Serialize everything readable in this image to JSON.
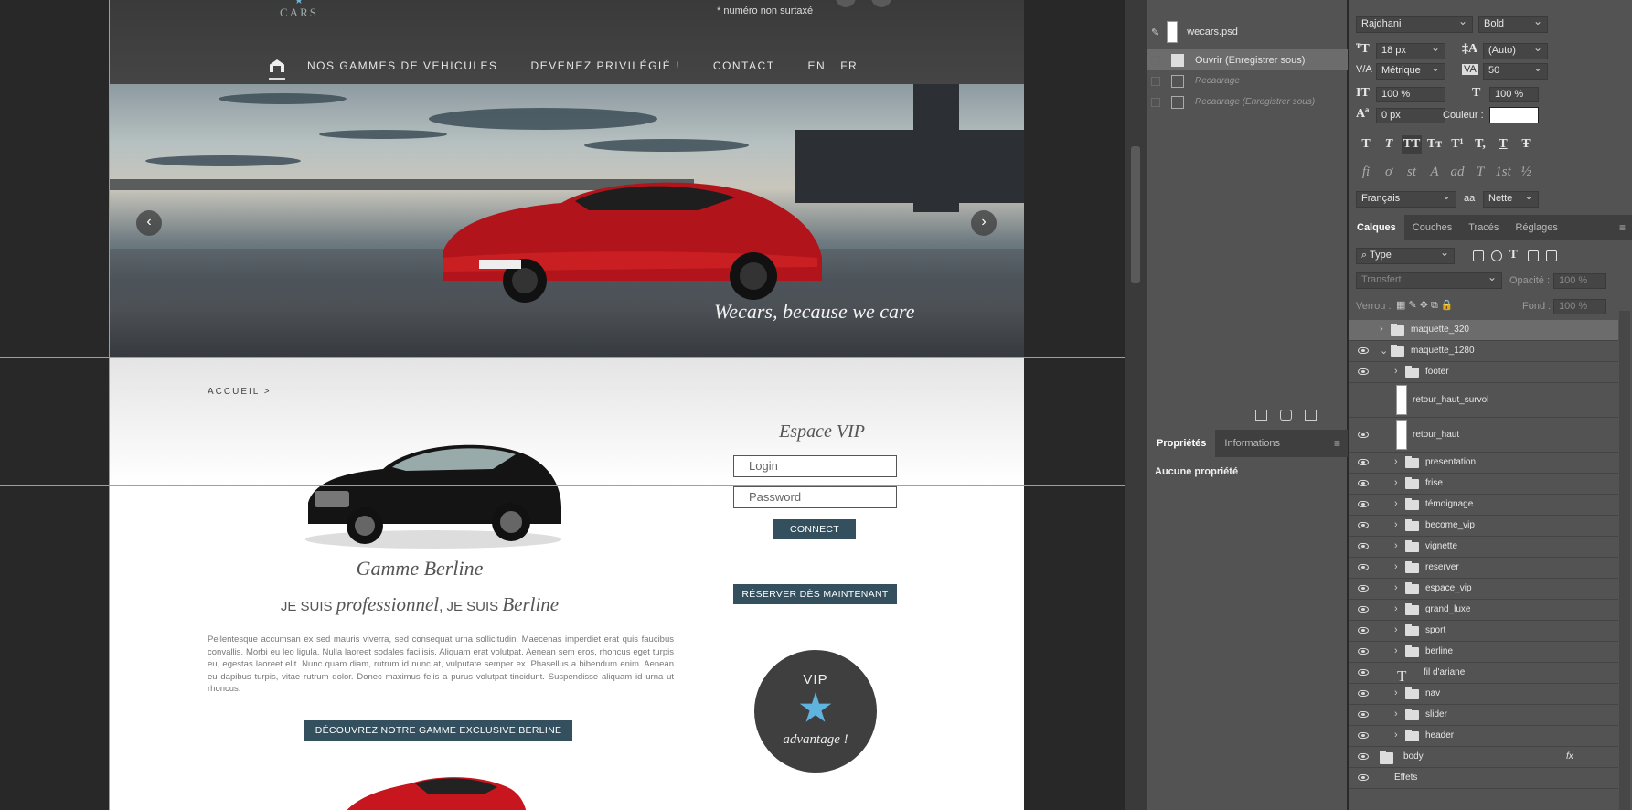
{
  "site": {
    "logo_text": "CARS",
    "subnote": "* numéro non surtaxé",
    "nav": [
      "NOS GAMMES DE VEHICULES",
      "DEVENEZ PRIVILÉGIÉ !",
      "CONTACT"
    ],
    "langs": [
      "EN",
      "FR"
    ],
    "slider_caption": "Wecars, because we care",
    "breadcrumb": "ACCUEIL >",
    "gamme_title": "Gamme Berline",
    "gamme_sub": {
      "a": "JE SUIS",
      "b": "professionnel",
      "c": ", JE SUIS",
      "d": "Berline"
    },
    "lorem": "Pellentesque accumsan ex sed mauris viverra, sed consequat urna sollicitudin. Maecenas imperdiet erat quis faucibus convallis. Morbi eu leo ligula. Nulla laoreet sodales facilisis. Aliquam erat volutpat. Aenean sem eros, rhoncus eget turpis eu, egestas laoreet elit. Nunc quam diam, rutrum id nunc at, vulputate semper ex. Phasellus a bibendum enim. Aenean eu dapibus turpis, vitae rutrum dolor. Donec maximus felis a purus volutpat tincidunt. Suspendisse aliquam id urna ut rhoncus.",
    "discover_btn": "DÉCOUVREZ NOTRE GAMME EXCLUSIVE BERLINE",
    "vip_title": "Espace VIP",
    "login_placeholder": "Login",
    "password_placeholder": "Password",
    "connect_btn": "CONNECT",
    "reserve_btn": "RÉSERVER DÈS MAINTENANT",
    "vip_badge": {
      "top": "VIP",
      "bottom": "advantage !"
    }
  },
  "history": {
    "snapshot": "wecars.psd",
    "items": [
      {
        "label": "Ouvrir (Enregistrer sous)",
        "selected": true
      },
      {
        "label": "Recadrage",
        "selected": false
      },
      {
        "label": "Recadrage (Enregistrer sous)",
        "selected": false
      }
    ]
  },
  "properties": {
    "tabs": [
      "Propriétés",
      "Informations"
    ],
    "empty_label": "Aucune propriété"
  },
  "character": {
    "font_family": "Rajdhani",
    "font_style": "Bold",
    "size": "18 px",
    "leading": "(Auto)",
    "kerning": "Métrique",
    "tracking": "50",
    "vscale": "100 %",
    "hscale": "100 %",
    "baseline": "0 px",
    "color_label": "Couleur :",
    "language": "Français",
    "antialias_label": "aa",
    "antialias": "Nette",
    "type_buttons": [
      "T",
      "T",
      "TT",
      "Tт",
      "T¹",
      "T,",
      "T",
      "Ŧ"
    ],
    "ot_buttons": [
      "fi",
      "ơ",
      "st",
      "A",
      "ad",
      "T",
      "1st",
      "½"
    ]
  },
  "layers_panel": {
    "tabs": [
      "Calques",
      "Couches",
      "Tracés",
      "Réglages"
    ],
    "filter": "Type",
    "blend": "Transfert",
    "opacity_label": "Opacité :",
    "opacity": "100 %",
    "lock_label": "Verrou :",
    "fill_label": "Fond :",
    "fill": "100 %",
    "layers": [
      {
        "name": "maquette_320",
        "kind": "folder",
        "level": 0,
        "visible": false,
        "selected": true
      },
      {
        "name": "maquette_1280",
        "kind": "folder",
        "level": 0,
        "visible": true,
        "open": true
      },
      {
        "name": "footer",
        "kind": "folder",
        "level": 1,
        "visible": true
      },
      {
        "name": "retour_haut_survol",
        "kind": "image",
        "level": 1,
        "visible": false
      },
      {
        "name": "retour_haut",
        "kind": "image",
        "level": 1,
        "visible": true
      },
      {
        "name": "presentation",
        "kind": "folder",
        "level": 1,
        "visible": true
      },
      {
        "name": "frise",
        "kind": "folder",
        "level": 1,
        "visible": true
      },
      {
        "name": "témoignage",
        "kind": "folder",
        "level": 1,
        "visible": true
      },
      {
        "name": "become_vip",
        "kind": "folder",
        "level": 1,
        "visible": true
      },
      {
        "name": "vignette",
        "kind": "folder",
        "level": 1,
        "visible": true
      },
      {
        "name": "reserver",
        "kind": "folder",
        "level": 1,
        "visible": true
      },
      {
        "name": "espace_vip",
        "kind": "folder",
        "level": 1,
        "visible": true
      },
      {
        "name": "grand_luxe",
        "kind": "folder",
        "level": 1,
        "visible": true
      },
      {
        "name": "sport",
        "kind": "folder",
        "level": 1,
        "visible": true
      },
      {
        "name": "berline",
        "kind": "folder",
        "level": 1,
        "visible": true
      },
      {
        "name": "fil d'ariane",
        "kind": "text",
        "level": 1,
        "visible": true
      },
      {
        "name": "nav",
        "kind": "folder",
        "level": 1,
        "visible": true
      },
      {
        "name": "slider",
        "kind": "folder",
        "level": 1,
        "visible": true
      },
      {
        "name": "header",
        "kind": "folder",
        "level": 1,
        "visible": true
      },
      {
        "name": "body",
        "kind": "body",
        "level": 0,
        "visible": true,
        "fx": "fx"
      },
      {
        "name": "Effets",
        "kind": "effects",
        "level": 1,
        "visible": true
      }
    ]
  },
  "colors": {
    "accent": "#34505e",
    "vip_star": "#5fb3de",
    "guide": "#39c8d8"
  }
}
